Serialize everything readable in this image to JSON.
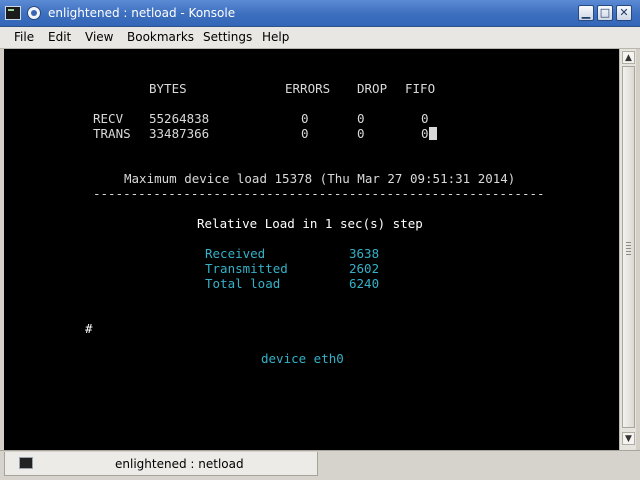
{
  "window": {
    "title": "enlightened : netload - Konsole",
    "buttons": {
      "minimize": "▁",
      "maximize": "□",
      "close": "✕"
    }
  },
  "menu": {
    "items": [
      "File",
      "Edit",
      "View",
      "Bookmarks",
      "Settings",
      "Help"
    ]
  },
  "netload": {
    "headers": {
      "bytes": "BYTES",
      "errors": "ERRORS",
      "drop": "DROP",
      "fifo": "FIFO"
    },
    "recv": {
      "label": "RECV",
      "bytes": "55264838",
      "errors": "0",
      "drop": "0",
      "fifo": "0"
    },
    "trans": {
      "label": "TRANS",
      "bytes": "33487366",
      "errors": "0",
      "drop": "0",
      "fifo": "0"
    },
    "max_load": "Maximum device load 15378 (Thu Mar 27 09:51:31 2014)",
    "separator": "------------------------------------------------------------",
    "relative_load": "Relative Load in 1 sec(s) step",
    "stats": [
      {
        "label": "Received",
        "value": "3638"
      },
      {
        "label": "Transmitted",
        "value": "2602"
      },
      {
        "label": "Total load",
        "value": "6240"
      }
    ],
    "prompt": "#",
    "device": "device eth0"
  },
  "tab": {
    "label": "enlightened : netload"
  }
}
